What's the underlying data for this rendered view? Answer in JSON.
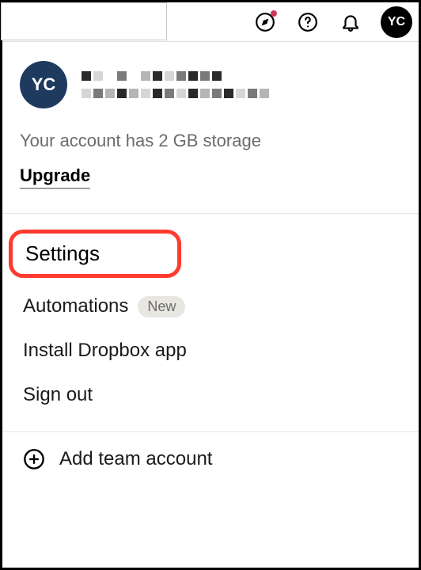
{
  "topbar": {
    "avatar_initials": "YC"
  },
  "profile": {
    "avatar_initials": "YC",
    "storage_text": "Your account has 2 GB storage",
    "upgrade_label": "Upgrade"
  },
  "menu": {
    "settings_label": "Settings",
    "automations_label": "Automations",
    "automations_badge": "New",
    "install_label": "Install Dropbox app",
    "signout_label": "Sign out",
    "add_team_label": "Add team account"
  }
}
